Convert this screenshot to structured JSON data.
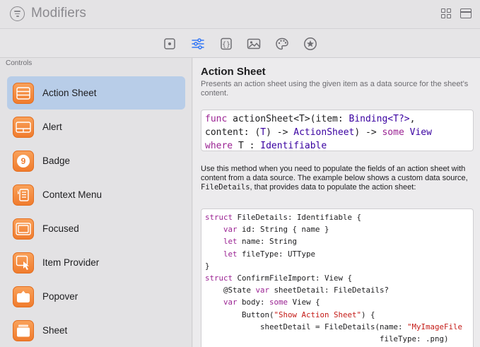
{
  "window": {
    "title": "Modifiers"
  },
  "colors": {
    "accent": "#3478f6",
    "selection": "#b8cde8",
    "app_icon": "#f58a3c",
    "keyword": "#9b2393",
    "type": "#3900a0",
    "string": "#c41a16"
  },
  "toolbar": {
    "items": [
      {
        "icon": "square-dot-icon",
        "selected": false
      },
      {
        "icon": "sliders-icon",
        "selected": true
      },
      {
        "icon": "braces-icon",
        "selected": false
      },
      {
        "icon": "photo-icon",
        "selected": false
      },
      {
        "icon": "palette-icon",
        "selected": false
      },
      {
        "icon": "star-circle-icon",
        "selected": false
      }
    ]
  },
  "sidebar": {
    "section_title": "Controls",
    "items": [
      {
        "label": "Action Sheet",
        "icon": "action-sheet-icon",
        "selected": true
      },
      {
        "label": "Alert",
        "icon": "alert-icon",
        "selected": false
      },
      {
        "label": "Badge",
        "icon": "badge-icon",
        "selected": false
      },
      {
        "label": "Context Menu",
        "icon": "context-menu-icon",
        "selected": false
      },
      {
        "label": "Focused",
        "icon": "focused-icon",
        "selected": false
      },
      {
        "label": "Item Provider",
        "icon": "item-provider-icon",
        "selected": false
      },
      {
        "label": "Popover",
        "icon": "popover-icon",
        "selected": false
      },
      {
        "label": "Sheet",
        "icon": "sheet-icon",
        "selected": false
      }
    ],
    "badge_number": "9"
  },
  "detail": {
    "title": "Action Sheet",
    "summary": "Presents an action sheet using the given item as a data source for the sheet’s content.",
    "signature": {
      "l1_kw": "func",
      "l1_rest": " actionSheet<T>(item: ",
      "l1_ty": "Binding<T?>",
      "l1_end": ",",
      "l2_start": "content: (",
      "l2_t": "T",
      "l2_mid": ") -> ",
      "l2_ty1": "ActionSheet",
      "l2_mid2": ") -> ",
      "l2_kw": "some",
      "l2_sp": " ",
      "l2_ty2": "View",
      "l3_kw": "where",
      "l3_mid": " T : ",
      "l3_ty": "Identifiable"
    },
    "body_before": "Use this method when you need to populate the fields of an action sheet with content from a data source. The example below shows a custom data source, ",
    "body_code": "FileDetails",
    "body_after": ", that provides data to populate the action sheet:",
    "code_lines": [
      "struct FileDetails: Identifiable {",
      "    var id: String { name }",
      "    let name: String",
      "    let fileType: UTType",
      "}",
      "struct ConfirmFileImport: View {",
      "    @State var sheetDetail: FileDetails?",
      "    var body: some View {",
      "        Button(\"Show Action Sheet\") {",
      "            sheetDetail = FileDetails(name: \"MyImageFile",
      "                                      fileType: .png)",
      "        }"
    ]
  }
}
